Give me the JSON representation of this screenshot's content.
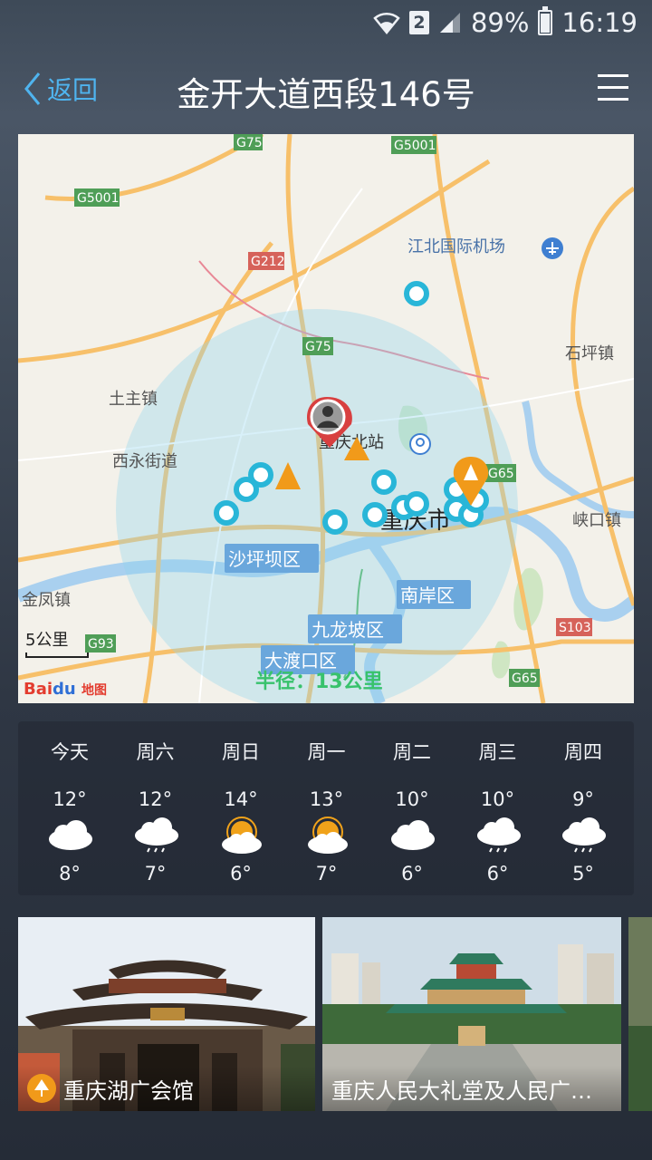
{
  "status_bar": {
    "battery": "89%",
    "time": "16:19",
    "sim": "2"
  },
  "header": {
    "back_label": "返回",
    "title": "金开大道西段146号"
  },
  "map": {
    "place_labels": {
      "airport": "江北国际机场",
      "north_station": "重庆北站",
      "city": "重庆市",
      "tuzhu": "土主镇",
      "xiyong": "西永街道",
      "shapingba": "沙坪坝区",
      "nanan": "南岸区",
      "jiulongpo": "九龙坡区",
      "dadukou": "大渡口区",
      "jinfeng": "金凤镇",
      "shiping": "石坪镇",
      "xiakou": "峡口镇"
    },
    "road_labels": {
      "g75_top": "G75",
      "g5001_top": "G5001",
      "g5001_left": "G5001",
      "g212": "G212",
      "g75_mid": "G75",
      "g65_right": "G65",
      "s103": "S103",
      "g93": "G93",
      "g65_bottom": "G65"
    },
    "scale": "5公里",
    "radius_label": "半径：13公里",
    "brand": "Bai",
    "brand_map": "地图",
    "colors": {
      "accent": "#4fb4ef",
      "radius": "#38c26c",
      "pin": "#29b6d8",
      "spot": "#f19a1a",
      "user": "#d84040"
    }
  },
  "weather": {
    "days": [
      {
        "name": "今天",
        "high": "12°",
        "low": "8°",
        "icon": "cloudy"
      },
      {
        "name": "周六",
        "high": "12°",
        "low": "7°",
        "icon": "light-rain"
      },
      {
        "name": "周日",
        "high": "14°",
        "low": "6°",
        "icon": "partly-cloudy"
      },
      {
        "name": "周一",
        "high": "13°",
        "low": "7°",
        "icon": "partly-cloudy"
      },
      {
        "name": "周二",
        "high": "10°",
        "low": "6°",
        "icon": "cloudy"
      },
      {
        "name": "周三",
        "high": "10°",
        "low": "6°",
        "icon": "light-rain"
      },
      {
        "name": "周四",
        "high": "9°",
        "low": "5°",
        "icon": "light-rain"
      }
    ]
  },
  "spots": [
    {
      "name": "重庆湖广会馆"
    },
    {
      "name": "重庆人民大礼堂及人民广…"
    }
  ]
}
